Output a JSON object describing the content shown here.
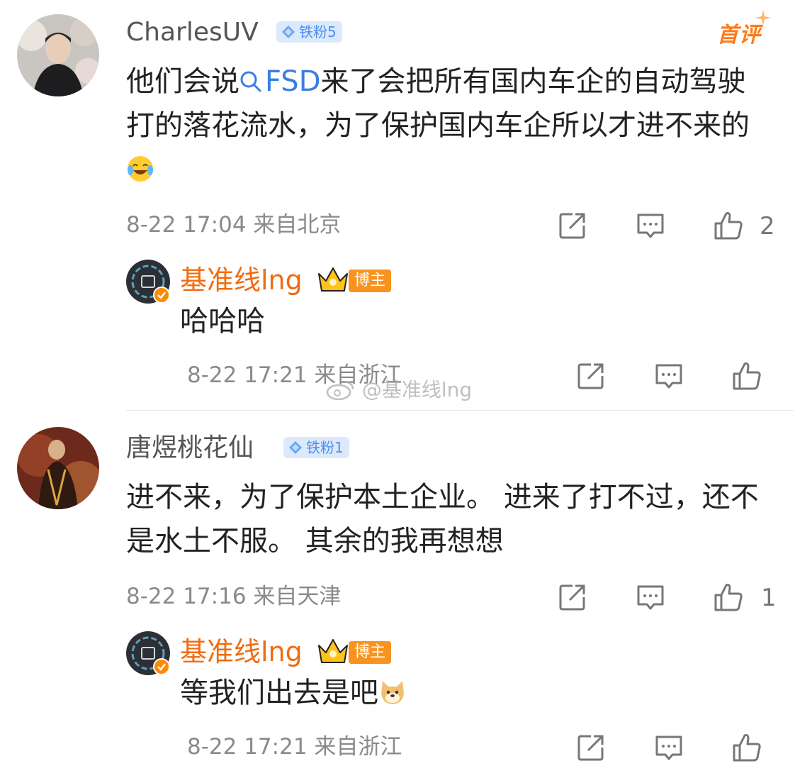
{
  "comments": [
    {
      "username": "CharlesUV",
      "fan_badge": "铁粉5",
      "tag": "首评",
      "text_before": "他们会说",
      "topic": "FSD",
      "text_after": "来了会把所有国内车企的自动驾驶打的落花流水，为了保护国内车企所以才进不来的",
      "meta": "8-22 17:04 来自北京",
      "likes": "2",
      "reply": {
        "username": "基准线lng",
        "host_badge": "博主",
        "text": "哈哈哈",
        "meta": "8-22 17:21 来自浙江"
      }
    },
    {
      "username": "唐煜桃花仙",
      "fan_badge": "铁粉1",
      "text": "进不来，为了保护本土企业。 进来了打不过，还不是水土不服。 其余的我再想想",
      "meta": "8-22 17:16 来自天津",
      "likes": "1",
      "reply": {
        "username": "基准线lng",
        "host_badge": "博主",
        "text": "等我们出去是吧",
        "meta": "8-22 17:21 来自浙江"
      }
    }
  ],
  "watermark": "@基准线lng",
  "icons": [
    "share-icon",
    "comment-icon",
    "like-icon",
    "laugh-cry-emoji",
    "doge-emoji",
    "search-icon",
    "crown-icon",
    "diamond-icon",
    "verified-icon"
  ],
  "colors": {
    "accent_orange": "#f26b0f",
    "link_blue": "#3b7de3",
    "badge_blue": "#4b8ef0",
    "meta_gray": "#8a8a8a"
  }
}
